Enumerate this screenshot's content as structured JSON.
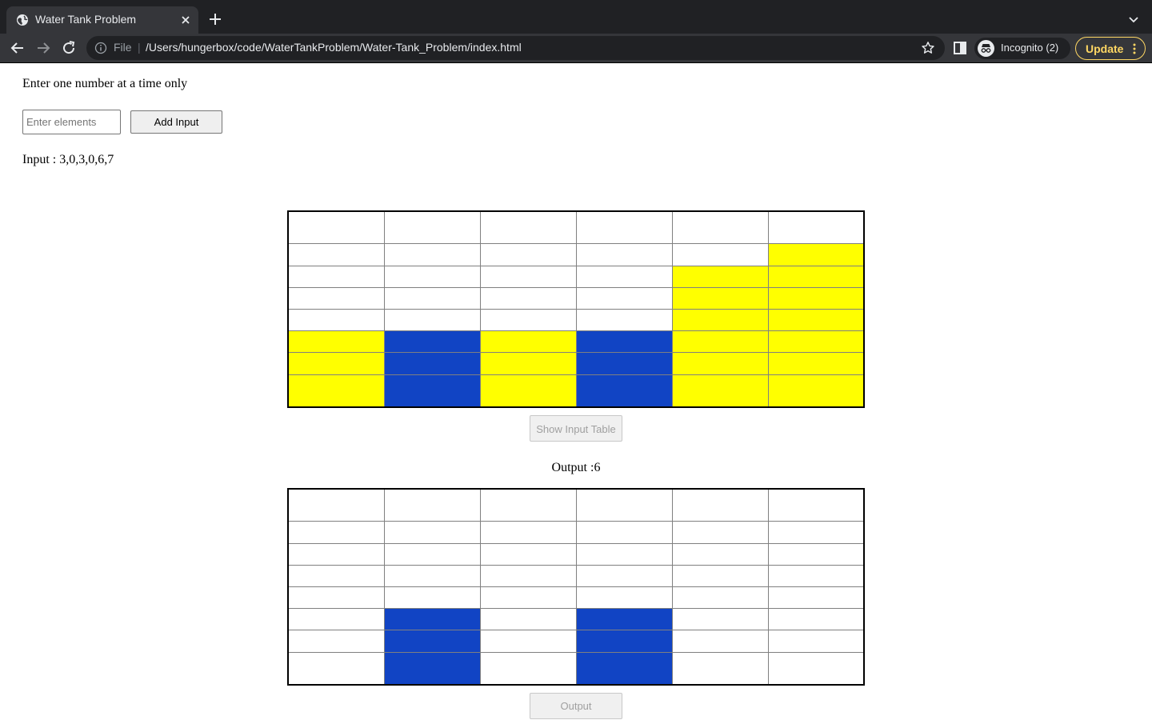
{
  "browser": {
    "tab_title": "Water Tank Problem",
    "scheme": "File",
    "url": "/Users/hungerbox/code/WaterTankProblem/Water-Tank_Problem/index.html",
    "profile_label": "Incognito (2)",
    "update_label": "Update",
    "icons": [
      "globe-icon",
      "close-icon",
      "plus-icon",
      "chevron-down-icon",
      "back-arrow-icon",
      "forward-arrow-icon",
      "reload-icon",
      "info-icon",
      "star-icon",
      "side-panel-icon",
      "incognito-icon",
      "kebab-menu-icon"
    ]
  },
  "page": {
    "instruction": "Enter one number at a time only",
    "input_placeholder": "Enter elements",
    "add_button": "Add Input",
    "input_text": "Input : 3,0,3,0,6,7",
    "show_button": "Show Input Table",
    "output_text": "Output :6",
    "output_button": "Output"
  },
  "tank": {
    "rows": 8,
    "heights": [
      3,
      0,
      3,
      0,
      6,
      7
    ],
    "water": [
      0,
      3,
      0,
      3,
      0,
      0
    ],
    "colors": {
      "wall": "#ffff00",
      "water": "#1144c4",
      "empty": "#ffffff"
    }
  }
}
